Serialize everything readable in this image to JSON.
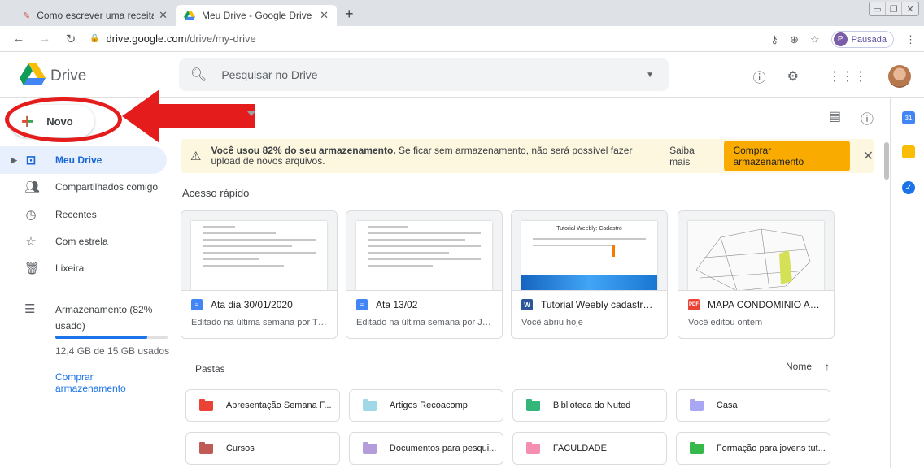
{
  "browser": {
    "tabs": [
      {
        "title": "Como escrever uma receita",
        "active": false
      },
      {
        "title": "Meu Drive - Google Drive",
        "active": true
      }
    ],
    "url_host": "drive.google.com",
    "url_path": "/drive/my-drive",
    "profile_initial": "P",
    "profile_label": "Pausada"
  },
  "header": {
    "app_name": "Drive",
    "search_placeholder": "Pesquisar no Drive"
  },
  "sidebar": {
    "new_label": "Novo",
    "items": [
      {
        "label": "Meu Drive",
        "icon": "my-drive-icon",
        "selected": true
      },
      {
        "label": "Compartilhados comigo",
        "icon": "shared-icon"
      },
      {
        "label": "Recentes",
        "icon": "clock-icon"
      },
      {
        "label": "Com estrela",
        "icon": "star-icon"
      },
      {
        "label": "Lixeira",
        "icon": "trash-icon"
      }
    ],
    "storage": {
      "label": "Armazenamento (82% usado)",
      "used_text": "12,4 GB de 15 GB usados",
      "fraction_used": 0.82,
      "buy_label": "Comprar armazenamento"
    }
  },
  "banner": {
    "bold": "Você usou 82% do seu armazenamento.",
    "rest": " Se ficar sem armazenamento, não será possível fazer upload de novos arquivos.",
    "learn_more": "Saiba mais",
    "buy": "Comprar armazenamento"
  },
  "quick_access": {
    "title": "Acesso rápido",
    "cards": [
      {
        "name": "Ata dia 30/01/2020",
        "sub": "Editado na última semana por Tás...",
        "type": "doc",
        "color": "#4285f4",
        "badge": ""
      },
      {
        "name": "Ata 13/02",
        "sub": "Editado na última semana por Joz...",
        "type": "doc",
        "color": "#4285f4",
        "badge": ""
      },
      {
        "name": "Tutorial Weebly cadastro B...",
        "sub": "Você abriu hoje",
        "type": "word",
        "color": "#2b579a",
        "badge": "W"
      },
      {
        "name": "MAPA CONDOMINIO AGUA...",
        "sub": "Você editou ontem",
        "type": "pdf",
        "color": "#ea4335",
        "badge": "PDF"
      }
    ],
    "thumb_tutorial_title": "Tutorial Weebly: Cadastro"
  },
  "folders": {
    "title": "Pastas",
    "sort_label": "Nome",
    "items": [
      {
        "name": "Apresentação Semana F...",
        "color": "#ea4335"
      },
      {
        "name": "Artigos Recoacomp",
        "color": "#9fd8e6"
      },
      {
        "name": "Biblioteca do Nuted",
        "color": "#34b67a"
      },
      {
        "name": "Casa",
        "color": "#a8a6f5"
      },
      {
        "name": "Cursos",
        "color": "#c05a55"
      },
      {
        "name": "Documentos para pesqui...",
        "color": "#b39ddb"
      },
      {
        "name": "FACULDADE",
        "color": "#f48fb1"
      },
      {
        "name": "Formação para jovens tut...",
        "color": "#34b94a"
      }
    ]
  },
  "side_panel": [
    "calendar-icon",
    "keep-icon",
    "tasks-icon"
  ]
}
